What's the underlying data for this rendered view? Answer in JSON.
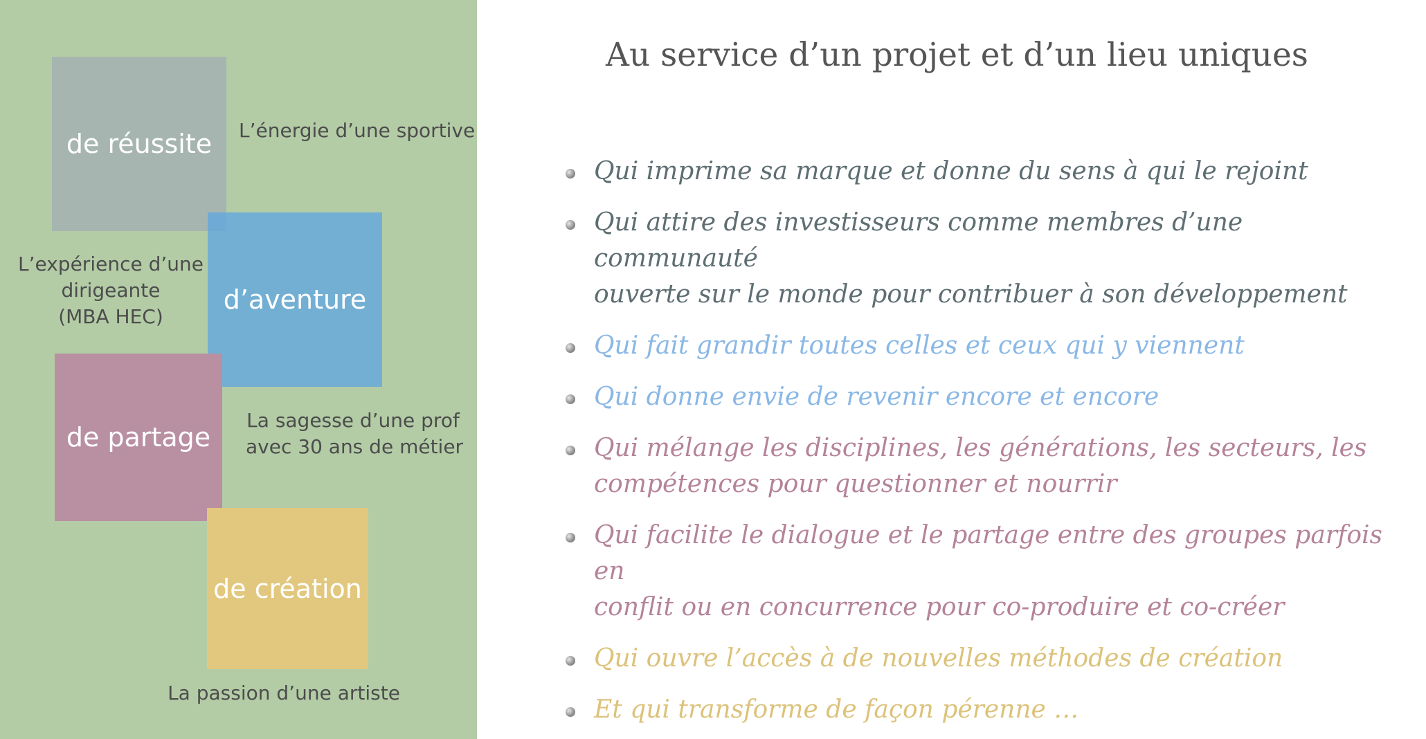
{
  "left_panel": {
    "boxes": [
      {
        "label": "de réussite",
        "color": "#a7b5b0"
      },
      {
        "label": "d’aventure",
        "color": "#62a8de"
      },
      {
        "label": "de partage",
        "color": "#b98fa2"
      },
      {
        "label": "de création",
        "color": "#e2c87e"
      }
    ],
    "captions": {
      "sportive": "L’énergie d’une sportive",
      "dirigeante_line1": "L’expérience d’une",
      "dirigeante_line2": "dirigeante",
      "dirigeante_line3": "(MBA HEC)",
      "prof_line1": "La sagesse d’une prof",
      "prof_line2": "avec 30 ans de métier",
      "artiste": "La passion d’une artiste"
    },
    "background_color": "#b3cca6"
  },
  "main": {
    "title": "Au service d’un projet et d’un lieu uniques",
    "bullets": [
      {
        "lines": [
          "Qui imprime sa marque et donne du sens à qui le rejoint"
        ],
        "color": "#5e6e72"
      },
      {
        "lines": [
          "Qui attire des investisseurs comme membres d’une communauté",
          "ouverte sur le monde pour contribuer à son développement"
        ],
        "color": "#5e6e72"
      },
      {
        "lines": [
          "Qui fait grandir toutes celles et ceux qui y viennent"
        ],
        "color": "#8ab8e6"
      },
      {
        "lines": [
          "Qui donne envie de revenir encore et encore"
        ],
        "color": "#8ab8e6"
      },
      {
        "lines": [
          "Qui mélange les disciplines, les générations, les secteurs, les",
          "compétences pour questionner et nourrir"
        ],
        "color": "#b58399"
      },
      {
        "lines": [
          "Qui facilite le dialogue et le partage entre des groupes parfois en",
          "conflit ou en concurrence pour co-produire et co-créer"
        ],
        "color": "#b58399"
      },
      {
        "lines": [
          "Qui ouvre l’accès à de nouvelles méthodes de création"
        ],
        "color": "#dcc27a"
      },
      {
        "lines": [
          "Et qui transforme de façon pérenne …"
        ],
        "color": "#dcc27a"
      }
    ],
    "bullet_icon": "bullet-dot-icon"
  }
}
